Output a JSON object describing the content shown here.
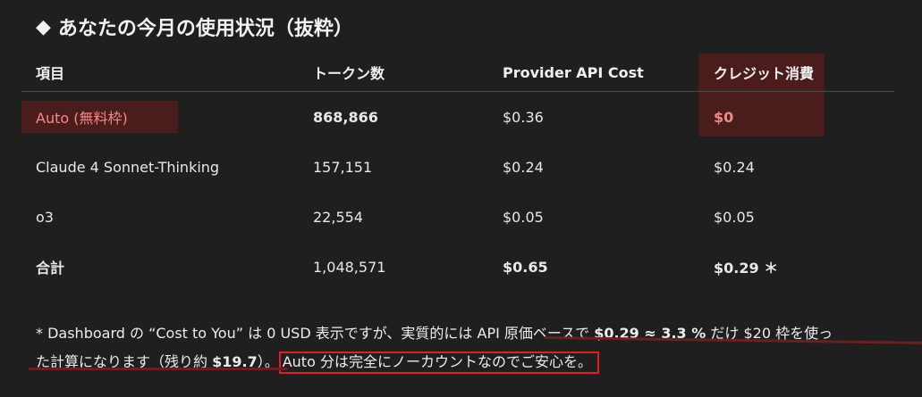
{
  "heading": {
    "icon": "diamond-icon",
    "text": "あなたの今月の使用状況（抜粋）"
  },
  "table": {
    "headers": [
      "項目",
      "トークン数",
      "Provider API Cost",
      "クレジット消費"
    ],
    "rows": [
      {
        "item": "Auto (無料枠)",
        "tokens": "868,866",
        "api_cost": "$0.36",
        "credit": "$0"
      },
      {
        "item": "Claude 4 Sonnet-Thinking",
        "tokens": "157,151",
        "api_cost": "$0.24",
        "credit": "$0.24"
      },
      {
        "item": "o3",
        "tokens": "22,554",
        "api_cost": "$0.05",
        "credit": "$0.05"
      },
      {
        "item": "合計",
        "tokens": "1,048,571",
        "api_cost": "$0.65",
        "credit": "$0.29 ＊"
      }
    ]
  },
  "note": {
    "p1": "* Dashboard の “Cost to You” は 0 USD 表示ですが、実質的には API 原価ベースで ",
    "b1": "$0.29 ≈ 3.3 %",
    "p2": " だけ $20 枠を使っ",
    "p3": "た計算になります（残り約 ",
    "b2": "$19.7",
    "p4": "）。",
    "boxed": "Auto 分は完全にノーカウントなのでご安心を。"
  },
  "colors": {
    "background": "#1f1f1f",
    "highlight": "#4a1d1c",
    "highlight_text": "#f08a86",
    "box_border": "#e02020"
  }
}
